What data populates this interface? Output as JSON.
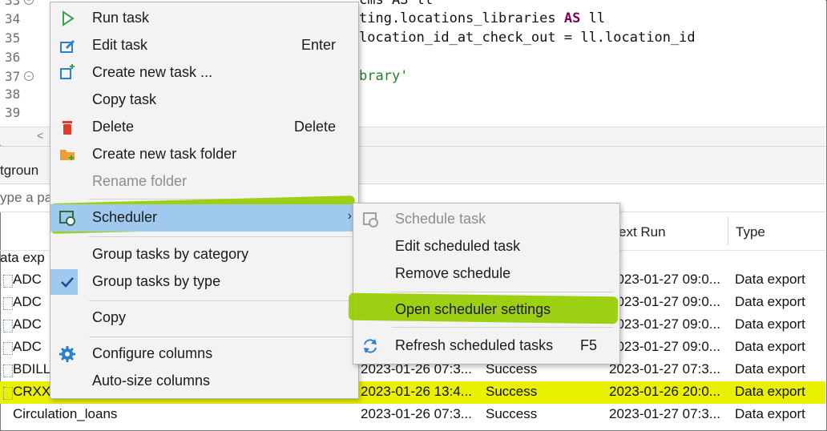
{
  "editor": {
    "lines": [
      {
        "num": "33",
        "text": ""
      },
      {
        "num": "34",
        "text": "ting.locations_libraries AS ll"
      },
      {
        "num": "35",
        "text": "location_id_at_check_out = ll.location_id"
      },
      {
        "num": "36",
        "text": ""
      },
      {
        "num": "37",
        "text": "brary'"
      },
      {
        "num": "38",
        "text": ""
      },
      {
        "num": "39",
        "text": ""
      }
    ],
    "line33_tail": "cms AS ll",
    "line34_pre": "ting.locations_libraries ",
    "line34_kw": "AS",
    "line34_post": " ll",
    "line35": "location_id_at_check_out = ll.location_id",
    "line37_str": "brary'"
  },
  "panel": {
    "tab_label": "tgroun",
    "filter_placeholder": "ype a pa",
    "columns": {
      "next_run": "ext Run",
      "type": "Type",
      "group_label": "ata exp"
    }
  },
  "rows": [
    {
      "name": "ADC",
      "last_run": "",
      "status": "",
      "next_run": "2023-01-27 09:0...",
      "type": "Data export"
    },
    {
      "name": "ADC",
      "last_run": "",
      "status": "",
      "next_run": "2023-01-27 09:0...",
      "type": "Data export"
    },
    {
      "name": "ADC",
      "last_run": "",
      "status": "",
      "next_run": "2023-01-27 09:0...",
      "type": "Data export"
    },
    {
      "name": "ADC",
      "last_run": "",
      "status": "",
      "next_run": "2023-01-27 09:0...",
      "type": "Data export"
    },
    {
      "name": "BDILL",
      "last_run": "2023-01-26 07:3...",
      "status": "Success",
      "next_run": "2023-01-27 07:3...",
      "type": "Data export"
    },
    {
      "name": "CRXX",
      "last_run": "2023-01-26 13:4...",
      "status": "Success",
      "next_run": "2023-01-26 20:0...",
      "type": "Data export"
    },
    {
      "name": "Circulation_loans",
      "last_run": "2023-01-26 07:3...",
      "status": "Success",
      "next_run": "2023-01-27 07:3...",
      "type": "Data export"
    }
  ],
  "context_menu": {
    "run_task": "Run task",
    "edit_task": "Edit task",
    "edit_task_shortcut": "Enter",
    "create_new_task": "Create new task ...",
    "copy_task": "Copy task",
    "delete": "Delete",
    "delete_shortcut": "Delete",
    "create_new_task_folder": "Create new task folder",
    "rename_folder": "Rename folder",
    "scheduler": "Scheduler",
    "scheduler_arrow": "›",
    "group_by_category": "Group tasks by category",
    "group_by_type": "Group tasks by type",
    "copy": "Copy",
    "configure_columns": "Configure columns",
    "auto_size_columns": "Auto-size columns"
  },
  "scheduler_menu": {
    "schedule_task": "Schedule task",
    "edit_scheduled_task": "Edit scheduled task",
    "remove_schedule": "Remove schedule",
    "open_scheduler_settings": "Open scheduler settings",
    "refresh_scheduled_tasks": "Refresh scheduled tasks",
    "refresh_shortcut": "F5"
  },
  "colors": {
    "highlight": "#96cc00",
    "selection": "#9fc9ef",
    "row_highlight": "#e9f000"
  }
}
